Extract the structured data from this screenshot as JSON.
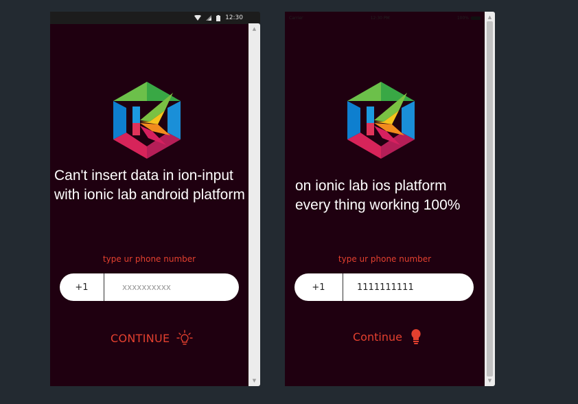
{
  "android": {
    "status": {
      "time": "12:30",
      "icons": [
        "wifi-icon",
        "signal-icon",
        "battery-icon"
      ]
    },
    "headline": "Can't insert data in ion-input with ionic lab android platform",
    "hint": "type ur phone number",
    "country_code": "+1",
    "phone_placeholder": "xxxxxxxxxx",
    "phone_value": "",
    "continue_label": "CONTINUE",
    "continue_icon": "lightbulb-outline-icon"
  },
  "ios": {
    "status": {
      "left": "Carrier",
      "center": "12:30 PM",
      "right": "100%"
    },
    "headline": "on ionic lab ios platform every thing working 100%",
    "hint": "type ur phone number",
    "country_code": "+1",
    "phone_value": "1111111111",
    "continue_label": "Continue",
    "continue_icon": "lightbulb-filled-icon"
  },
  "colors": {
    "background": "#232a31",
    "device_background": "#1f0010",
    "accent": "#e3402f"
  }
}
